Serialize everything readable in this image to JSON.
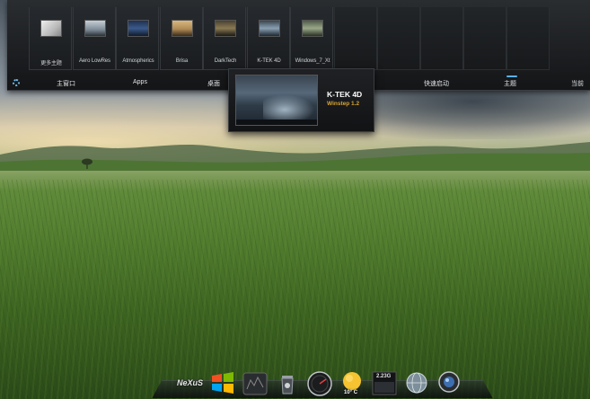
{
  "themes": [
    {
      "name": "更多主题",
      "icon": "more-themes-icon",
      "thumb_color": "#d9d9d9"
    },
    {
      "name": "Aero LowRes",
      "icon": "aero-lowres-thumbnail",
      "thumb_color": "#9aa7b2"
    },
    {
      "name": "Atmospherics",
      "icon": "atmospherics-thumbnail",
      "thumb_color": "#3b5a8a"
    },
    {
      "name": "Brisa",
      "icon": "brisa-thumbnail",
      "thumb_color": "#b08a55"
    },
    {
      "name": "DarkTech",
      "icon": "darktech-thumbnail",
      "thumb_color": "#7a6a4a"
    },
    {
      "name": "K-TEK 4D",
      "icon": "ktek-4d-thumbnail",
      "thumb_color": "#6f8090"
    },
    {
      "name": "Windows_7_Xt",
      "icon": "windows-7-xt-thumbnail",
      "thumb_color": "#7f8c70"
    }
  ],
  "tabs": [
    {
      "label": "主窗口"
    },
    {
      "label": "Apps"
    },
    {
      "label": "桌面"
    },
    {
      "label": "快速启动"
    },
    {
      "label": "主题"
    },
    {
      "label": "当前"
    }
  ],
  "tooltip": {
    "title": "K-TEK 4D",
    "subtitle": "Winstep 1.2"
  },
  "dock": {
    "nexus_label": "NeXuS",
    "memory_label": "2.23G",
    "weather_temp": "10° C",
    "icons": [
      "nexus-logo-icon",
      "windows-logo-icon",
      "clock-icon",
      "recycle-bin-icon",
      "cpu-meter-icon",
      "weather-icon",
      "memory-meter-icon",
      "globe-icon",
      "webcam-icon"
    ]
  },
  "colors": {
    "accent": "#5bb0e8",
    "tooltip_subtitle": "#d6a530"
  }
}
